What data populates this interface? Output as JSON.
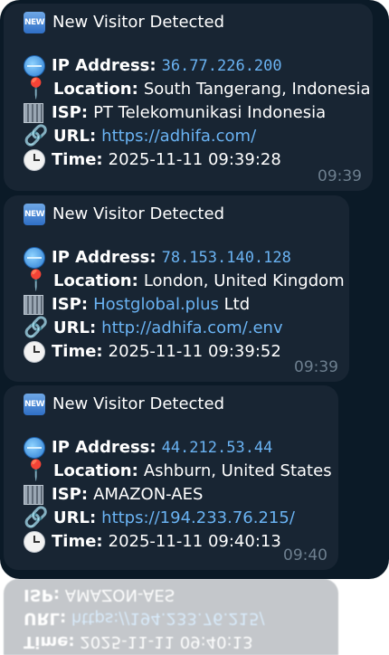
{
  "messages": [
    {
      "title": "New Visitor Detected",
      "ip_label": "IP Address:",
      "ip": "36.77.226.200",
      "location_label": "Location:",
      "location": "South Tangerang, Indonesia",
      "isp_label": "ISP:",
      "isp": "PT Telekomunikasi Indonesia",
      "url_label": "URL:",
      "url": "https://adhifa.com/",
      "time_label": "Time:",
      "time": "2025-11-11 09:39:28",
      "timestamp": "09:39"
    },
    {
      "title": "New Visitor Detected",
      "ip_label": "IP Address:",
      "ip": "78.153.140.128",
      "location_label": "Location:",
      "location": "London, United Kingdom",
      "isp_label": "ISP:",
      "isp_link": "Hostglobal.plus",
      "isp_suffix": " Ltd",
      "url_label": "URL:",
      "url": "http://adhifa.com/.env",
      "time_label": "Time:",
      "time": "2025-11-11 09:39:52",
      "timestamp": "09:39"
    },
    {
      "title": "New Visitor Detected",
      "ip_label": "IP Address:",
      "ip": "44.212.53.44",
      "location_label": "Location:",
      "location": "Ashburn, United States",
      "isp_label": "ISP:",
      "isp": "AMAZON-AES",
      "url_label": "URL:",
      "url": "https://194.233.76.215/",
      "time_label": "Time:",
      "time": "2025-11-11 09:40:13",
      "timestamp": "09:40"
    }
  ],
  "icons": {
    "badge": "NEW",
    "badge_icon": "new-button-icon",
    "ip": "globe-icon",
    "location": "pin-icon",
    "isp": "office-building-icon",
    "url": "link-icon",
    "time": "clock-icon"
  },
  "colors": {
    "background": "#0b1a27",
    "bubble": "#182533",
    "link": "#6ab3f3",
    "timestamp": "#6d7f8f"
  }
}
